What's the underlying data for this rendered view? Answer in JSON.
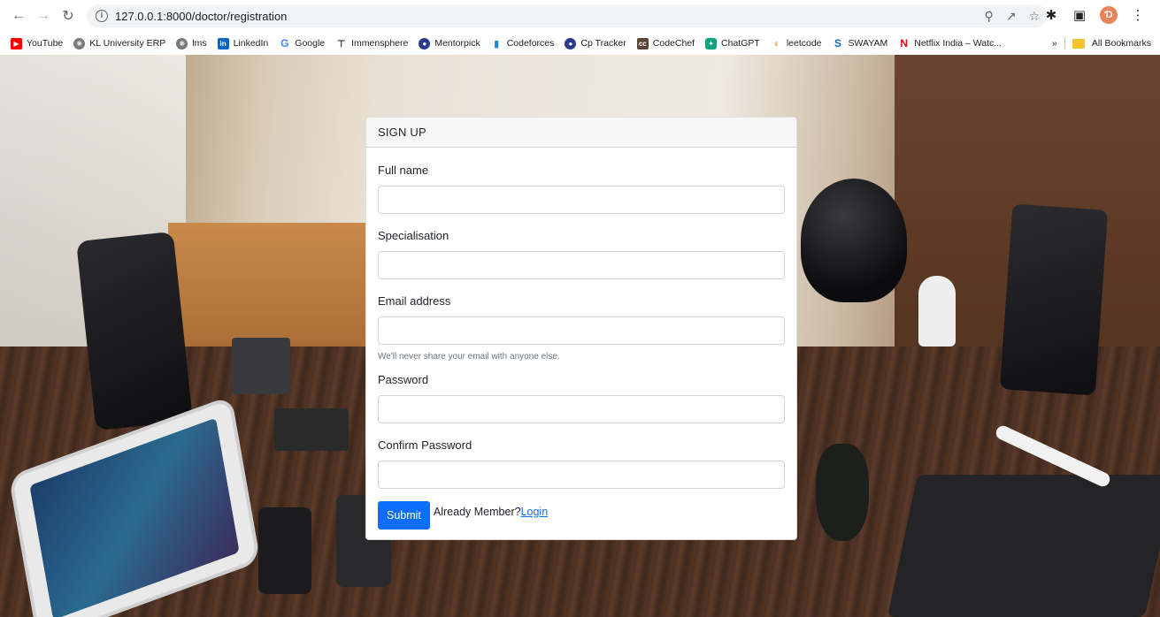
{
  "browser": {
    "url": "127.0.0.1:8000/doctor/registration",
    "bookmarks": [
      {
        "label": "YouTube",
        "color": "#ff0000"
      },
      {
        "label": "KL University ERP",
        "color": "#7a7a7a"
      },
      {
        "label": "lms",
        "color": "#7a7a7a"
      },
      {
        "label": "LinkedIn",
        "color": "#0a66c2"
      },
      {
        "label": "Google",
        "color": "#4285f4"
      },
      {
        "label": "Immensphere",
        "color": "#333333"
      },
      {
        "label": "Mentorpick",
        "color": "#2b3a8c"
      },
      {
        "label": "Codeforces",
        "color": "#1f8acb"
      },
      {
        "label": "Cp Tracker",
        "color": "#2b3a8c"
      },
      {
        "label": "CodeChef",
        "color": "#5b4638"
      },
      {
        "label": "ChatGPT",
        "color": "#10a37f"
      },
      {
        "label": "leetcode",
        "color": "#f89f1b"
      },
      {
        "label": "SWAYAM",
        "color": "#1565c0"
      },
      {
        "label": "Netflix India – Watc...",
        "color": "#e50914"
      }
    ],
    "overflow_label": "»",
    "all_bookmarks_label": "All Bookmarks",
    "profile_initial": "Ɗ"
  },
  "form": {
    "header": "SIGN UP",
    "full_name_label": "Full name",
    "specialisation_label": "Specialisation",
    "email_label": "Email address",
    "email_help": "We'll never share your email with anyone else.",
    "password_label": "Password",
    "confirm_password_label": "Confirm Password",
    "submit_label": "Submit",
    "already_member_text": "Already Member?",
    "login_link": "Login",
    "full_name_value": "",
    "specialisation_value": "",
    "email_value": "",
    "password_value": "",
    "confirm_password_value": ""
  },
  "colors": {
    "primary": "#0d6efd",
    "card_header_bg": "#f7f7f7"
  }
}
